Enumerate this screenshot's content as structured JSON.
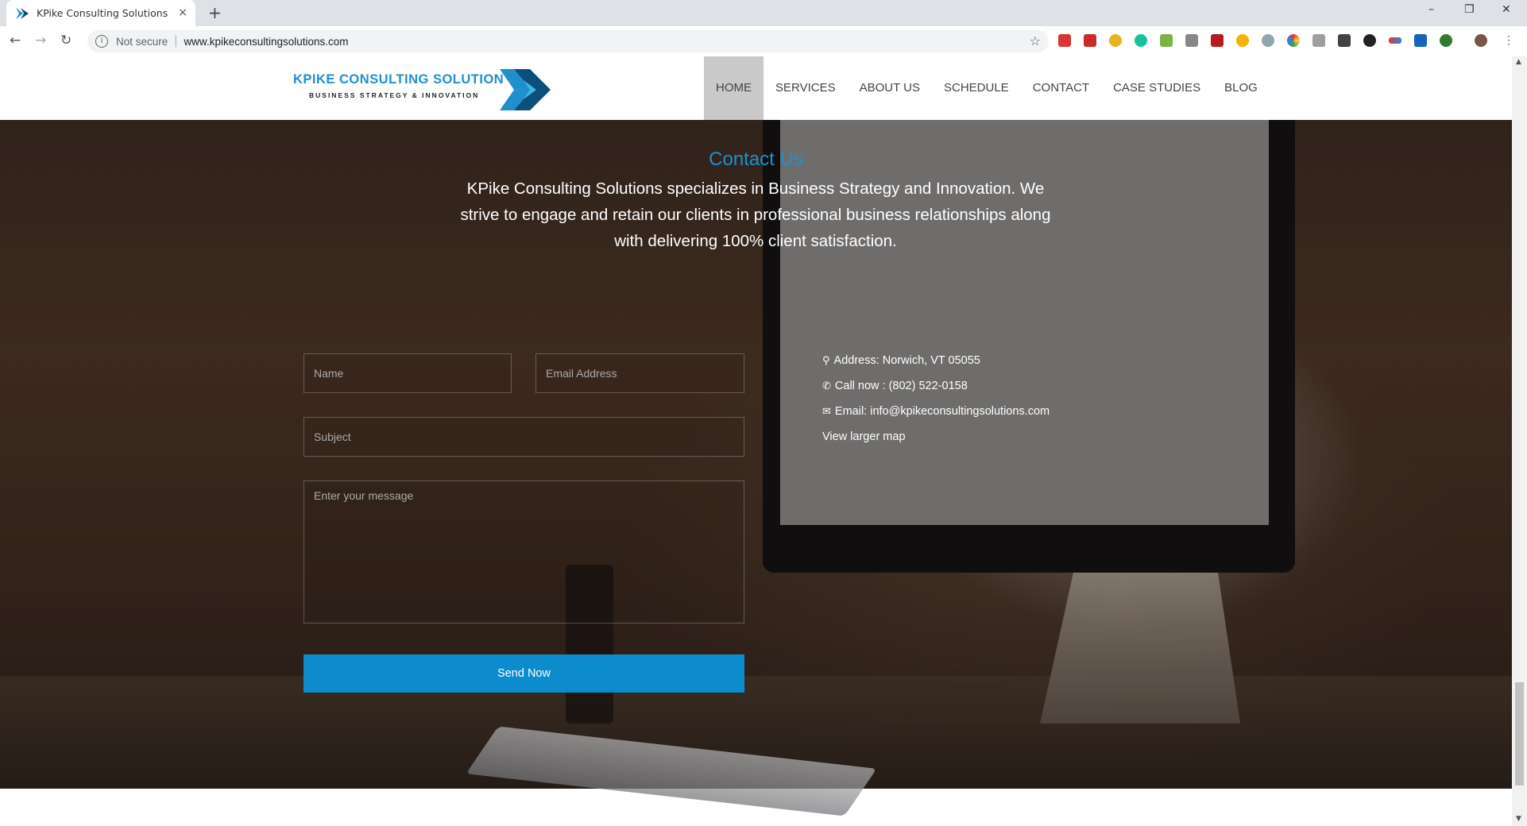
{
  "browser": {
    "tab_title": "KPike Consulting Solutions",
    "tab_close": "×",
    "new_tab": "+",
    "not_secure": "Not secure",
    "url": "www.kpikeconsultingsolutions.com",
    "win_minimize": "–",
    "win_restore": "❐",
    "win_close": "✕"
  },
  "site": {
    "logo_title": "KPIKE CONSULTING SOLUTION",
    "logo_subtitle": "BUSINESS STRATEGY & INNOVATION",
    "nav": [
      "HOME",
      "SERVICES",
      "ABOUT US",
      "SCHEDULE",
      "CONTACT",
      "CASE STUDIES",
      "BLOG"
    ],
    "active_nav": "HOME"
  },
  "contact": {
    "heading": "Contact Us",
    "intro": "KPike Consulting Solutions specializes in Business Strategy and Innovation. We strive to engage and retain our clients in professional business relationships along with delivering 100% client satisfaction.",
    "form": {
      "name_placeholder": "Name",
      "email_placeholder": "Email Address",
      "subject_placeholder": "Subject",
      "message_placeholder": "Enter your message",
      "send_label": "Send Now"
    },
    "info": {
      "address": "Address: Norwich, VT 05055",
      "phone": "Call now : (802) 522-0158",
      "email": "Email: info@kpikeconsultingsolutions.com",
      "map_link": "View larger map"
    }
  },
  "colors": {
    "accent": "#1f8fce",
    "button": "#0d8ccd",
    "nav_active_bg": "#c9c9c9"
  }
}
